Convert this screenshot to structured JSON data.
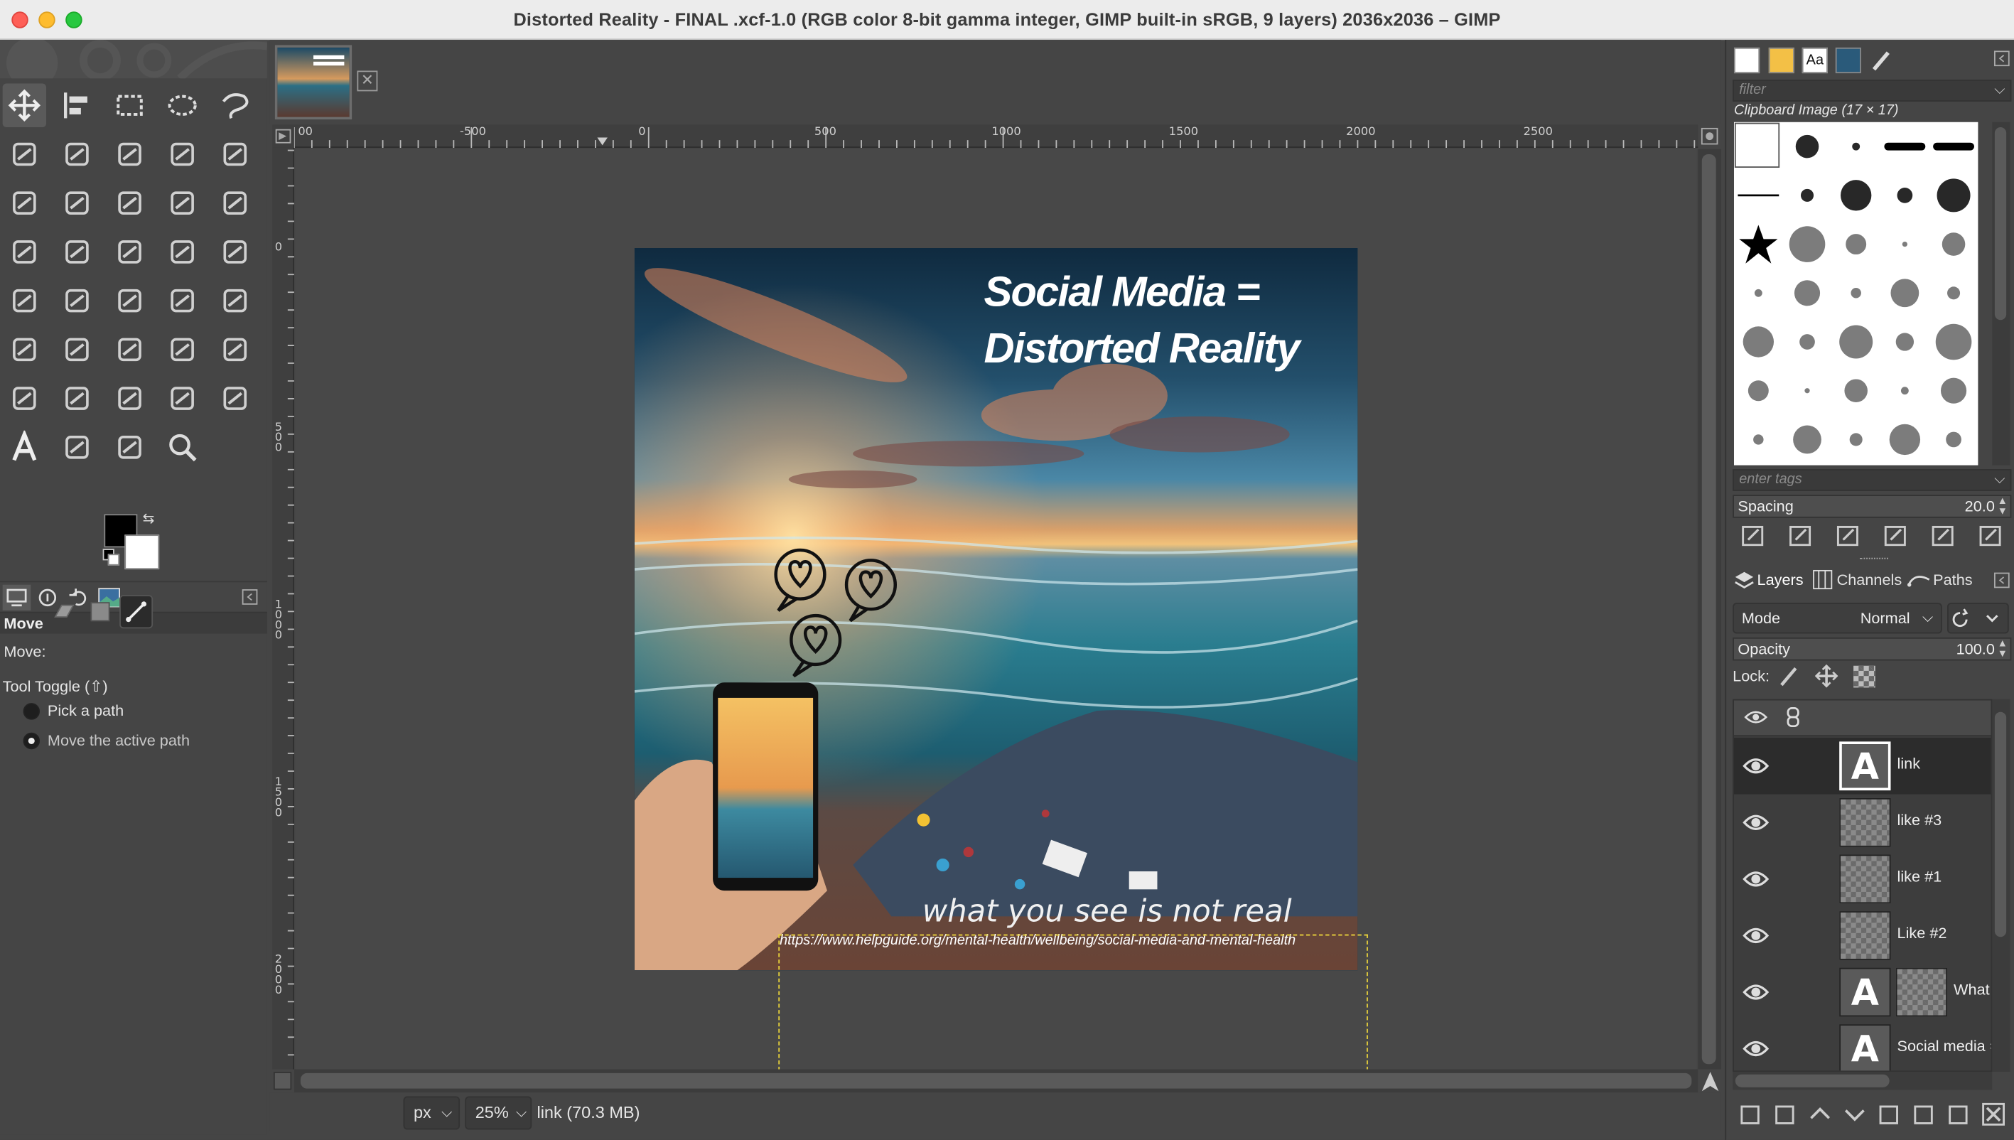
{
  "window": {
    "title": "Distorted Reality - FINAL .xcf-1.0 (RGB color 8-bit gamma integer, GIMP built-in sRGB, 9 layers) 2036x2036 – GIMP"
  },
  "toolbox": {
    "tools": [
      "move-tool-icon",
      "align-tool-icon",
      "rect-select-icon",
      "ellipse-select-icon",
      "free-select-icon",
      "scissors-select-icon",
      "foreground-select-icon",
      "fuzzy-select-icon",
      "select-by-color-icon",
      "crop-icon",
      "unified-transform-icon",
      "rotate-icon",
      "scale-icon",
      "shear-icon",
      "flip-icon",
      "perspective-icon",
      "3d-transform-icon",
      "warp-transform-icon",
      "handle-transform-icon",
      "cage-transform-icon",
      "bucket-fill-icon",
      "gradient-icon",
      "paintbrush-icon",
      "pencil-icon",
      "airbrush-icon",
      "ink-icon",
      "mypaint-brush-icon",
      "eraser-icon",
      "clone-icon",
      "heal-icon",
      "perspective-clone-icon",
      "smudge-icon",
      "blur-sharpen-icon",
      "dodge-burn-icon",
      "paths-icon",
      "text-icon",
      "color-picker-icon",
      "measure-icon",
      "zoom-icon"
    ]
  },
  "tool_options": {
    "title": "Move",
    "move_label": "Move:",
    "toggle_label": "Tool Toggle  (⇧)",
    "options": [
      "Pick a path",
      "Move the active path"
    ],
    "selected_option": "Move the active path"
  },
  "rulers": {
    "h": [
      "-500",
      "0",
      "500",
      "1000",
      "1500",
      "2000",
      "2500"
    ],
    "h_partial": "00",
    "v": [
      "0",
      "5\n0\n0",
      "1\n0\n0\n0",
      "1\n5\n0\n0",
      "2\n0\n0\n0"
    ]
  },
  "canvas": {
    "headline_1": "Social Media =",
    "headline_2": "Distorted Reality",
    "tagline": "what you see is not real",
    "url": "https://www.helpguide.org/mental-health/wellbeing/social-media-and-mental-health",
    "thumb_text": "Social Media = Distorted Reality"
  },
  "statusbar": {
    "unit": "px",
    "zoom": "25%",
    "info": "link (70.3 MB)"
  },
  "brushes": {
    "filter_placeholder": "filter",
    "current": "Clipboard Image (17 × 17)",
    "tags_placeholder": "enter tags",
    "spacing_label": "Spacing",
    "spacing_value": "20.0"
  },
  "layers_panel": {
    "tabs": [
      "Layers",
      "Channels",
      "Paths"
    ],
    "mode_label": "Mode",
    "mode_value": "Normal",
    "opacity_label": "Opacity",
    "opacity_value": "100.0",
    "lock_label": "Lock:",
    "layers": [
      {
        "name": "link",
        "type": "text",
        "visible": true,
        "selected": true
      },
      {
        "name": "like #3",
        "type": "raster",
        "visible": true,
        "selected": false
      },
      {
        "name": "like #1",
        "type": "raster",
        "visible": true,
        "selected": false
      },
      {
        "name": "Like #2",
        "type": "raster",
        "visible": true,
        "selected": false
      },
      {
        "name": "What",
        "type": "text-mask",
        "visible": true,
        "selected": false
      },
      {
        "name": "Social media =",
        "type": "text",
        "visible": true,
        "selected": false
      }
    ]
  },
  "colors": {
    "fg": "#000000",
    "bg": "#ffffff",
    "selection": "#e8d23b"
  }
}
